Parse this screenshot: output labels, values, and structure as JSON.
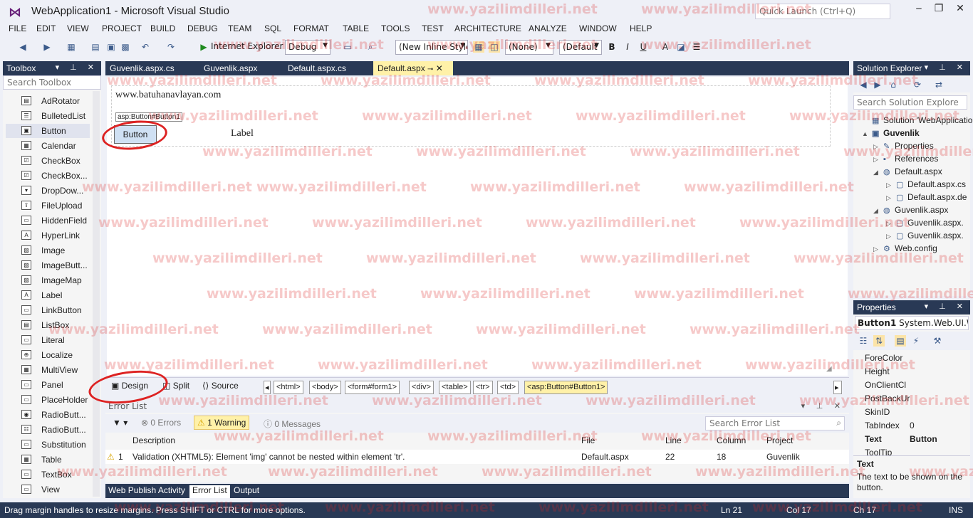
{
  "window": {
    "title": "WebApplication1 - Microsoft Visual Studio",
    "quick_launch_placeholder": "Quick Launch (Ctrl+Q)"
  },
  "menu": [
    "FILE",
    "EDIT",
    "VIEW",
    "PROJECT",
    "BUILD",
    "DEBUG",
    "TEAM",
    "SQL",
    "FORMAT",
    "TABLE",
    "TOOLS",
    "TEST",
    "ARCHITECTURE",
    "ANALYZE",
    "WINDOW",
    "HELP"
  ],
  "toolbar": {
    "browser": "Internet Explorer",
    "config": "Debug",
    "style": "(New Inline Style",
    "target_rule": "(None)",
    "font": "(Default"
  },
  "toolbox": {
    "title": "Toolbox",
    "search_placeholder": "Search Toolbox",
    "items": [
      "AdRotator",
      "BulletedList",
      "Button",
      "Calendar",
      "CheckBox",
      "CheckBox...",
      "DropDow...",
      "FileUpload",
      "HiddenField",
      "HyperLink",
      "Image",
      "ImageButt...",
      "ImageMap",
      "Label",
      "LinkButton",
      "ListBox",
      "Literal",
      "Localize",
      "MultiView",
      "Panel",
      "PlaceHolder",
      "RadioButt...",
      "RadioButt...",
      "Substitution",
      "Table",
      "TextBox",
      "View"
    ],
    "selected": "Button"
  },
  "tabs": [
    "Guvenlik.aspx.cs",
    "Guvenlik.aspx",
    "Default.aspx.cs",
    "Default.aspx"
  ],
  "active_tab": "Default.aspx",
  "design": {
    "site_text": "www.batuhanavlayan.com",
    "control_tag": "asp:Button#Button1",
    "button_label": "Button",
    "label_text": "Label"
  },
  "view_tabs": [
    "Design",
    "Split",
    "Source"
  ],
  "breadcrumbs": [
    "<html>",
    "<body>",
    "<form#form1>",
    "<div>",
    "<table>",
    "<tr>",
    "<td>",
    "<asp:Button#Button1>"
  ],
  "error_list": {
    "title": "Error List",
    "errors": "0 Errors",
    "warnings": "1 Warning",
    "messages": "0 Messages",
    "search_placeholder": "Search Error List",
    "columns": [
      "Description",
      "File",
      "Line",
      "Column",
      "Project"
    ],
    "rows": [
      {
        "num": "1",
        "description": "Validation (XHTML5): Element 'img' cannot be nested within element 'tr'.",
        "file": "Default.aspx",
        "line": "22",
        "column": "18",
        "project": "Guvenlik"
      }
    ]
  },
  "output_tabs": [
    "Web Publish Activity",
    "Error List",
    "Output"
  ],
  "solution_explorer": {
    "title": "Solution Explorer",
    "search_placeholder": "Search Solution Explore",
    "nodes": [
      {
        "label": "Solution 'WebApplication",
        "icon": "solution-icon",
        "expander": ""
      },
      {
        "label": "Guvenlik",
        "icon": "project-icon",
        "expander": "▲"
      },
      {
        "label": "Properties",
        "icon": "wrench-icon",
        "expander": "▷"
      },
      {
        "label": "References",
        "icon": "references-icon",
        "expander": "▷"
      },
      {
        "label": "Default.aspx",
        "icon": "globe-icon",
        "expander": "◢"
      },
      {
        "label": "Default.aspx.cs",
        "icon": "file-icon",
        "expander": "▷"
      },
      {
        "label": "Default.aspx.de",
        "icon": "file-icon",
        "expander": "▷"
      },
      {
        "label": "Guvenlik.aspx",
        "icon": "globe-icon",
        "expander": "◢"
      },
      {
        "label": "Guvenlik.aspx.",
        "icon": "file-icon",
        "expander": "▷"
      },
      {
        "label": "Guvenlik.aspx.",
        "icon": "file-icon",
        "expander": "▷"
      },
      {
        "label": "Web.config",
        "icon": "config-icon",
        "expander": "▷"
      }
    ]
  },
  "properties": {
    "title": "Properties",
    "object": "Button1",
    "object_type": "System.Web.UI.W",
    "rows": [
      {
        "name": "ForeColor",
        "value": ""
      },
      {
        "name": "Height",
        "value": ""
      },
      {
        "name": "OnClientCl",
        "value": ""
      },
      {
        "name": "PostBackUr",
        "value": ""
      },
      {
        "name": "SkinID",
        "value": ""
      },
      {
        "name": "TabIndex",
        "value": "0"
      },
      {
        "name": "Text",
        "value": "Button"
      },
      {
        "name": "ToolTip",
        "value": ""
      }
    ],
    "desc_title": "Text",
    "desc_text": "The text to be shown on the button."
  },
  "status": {
    "message": "Drag margin handles to resize margins. Press SHIFT or CTRL for more options.",
    "ln": "Ln 21",
    "col": "Col 17",
    "ch": "Ch 17",
    "mode": "INS"
  },
  "watermark": "www.yazilimdilleri.net",
  "colors": {
    "accent": "#293955",
    "title_blue": "#68217a",
    "highlight": "#fff1a8",
    "annotation": "#dd2222"
  }
}
